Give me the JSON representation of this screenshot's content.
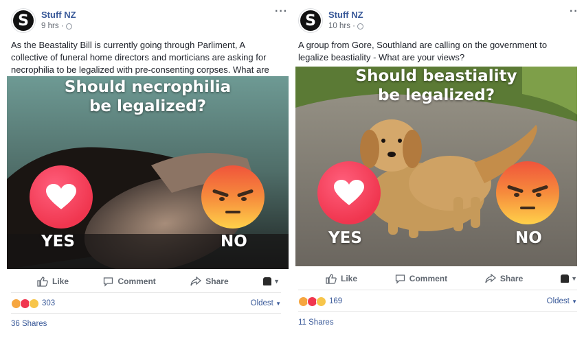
{
  "posts": [
    {
      "page_name": "Stuff NZ",
      "time": "9 hrs",
      "caption": "As the Beastality Bill is currently going through Parliment, A collective of funeral home directors and morticians are asking for necrophilia to be legalized with pre-consenting corpses. What are your views?",
      "image_title_line1": "Should necrophilia",
      "image_title_line2": "be legalized?",
      "yes_label": "YES",
      "no_label": "NO",
      "actions": {
        "like": "Like",
        "comment": "Comment",
        "share": "Share"
      },
      "reaction_count": "303",
      "sort_label": "Oldest",
      "shares": "36 Shares"
    },
    {
      "page_name": "Stuff NZ",
      "time": "10 hrs",
      "caption": "A group from Gore, Southland are calling on the government to legalize beastiality - What are your views?",
      "image_title_line1": "Should beastiality",
      "image_title_line2": "be legalized?",
      "yes_label": "YES",
      "no_label": "NO",
      "actions": {
        "like": "Like",
        "comment": "Comment",
        "share": "Share"
      },
      "reaction_count": "169",
      "sort_label": "Oldest",
      "shares": "11 Shares"
    }
  ],
  "avatar_letter": "S",
  "colors": {
    "link": "#385898",
    "heart": "#f0364f",
    "muted": "#606770"
  }
}
